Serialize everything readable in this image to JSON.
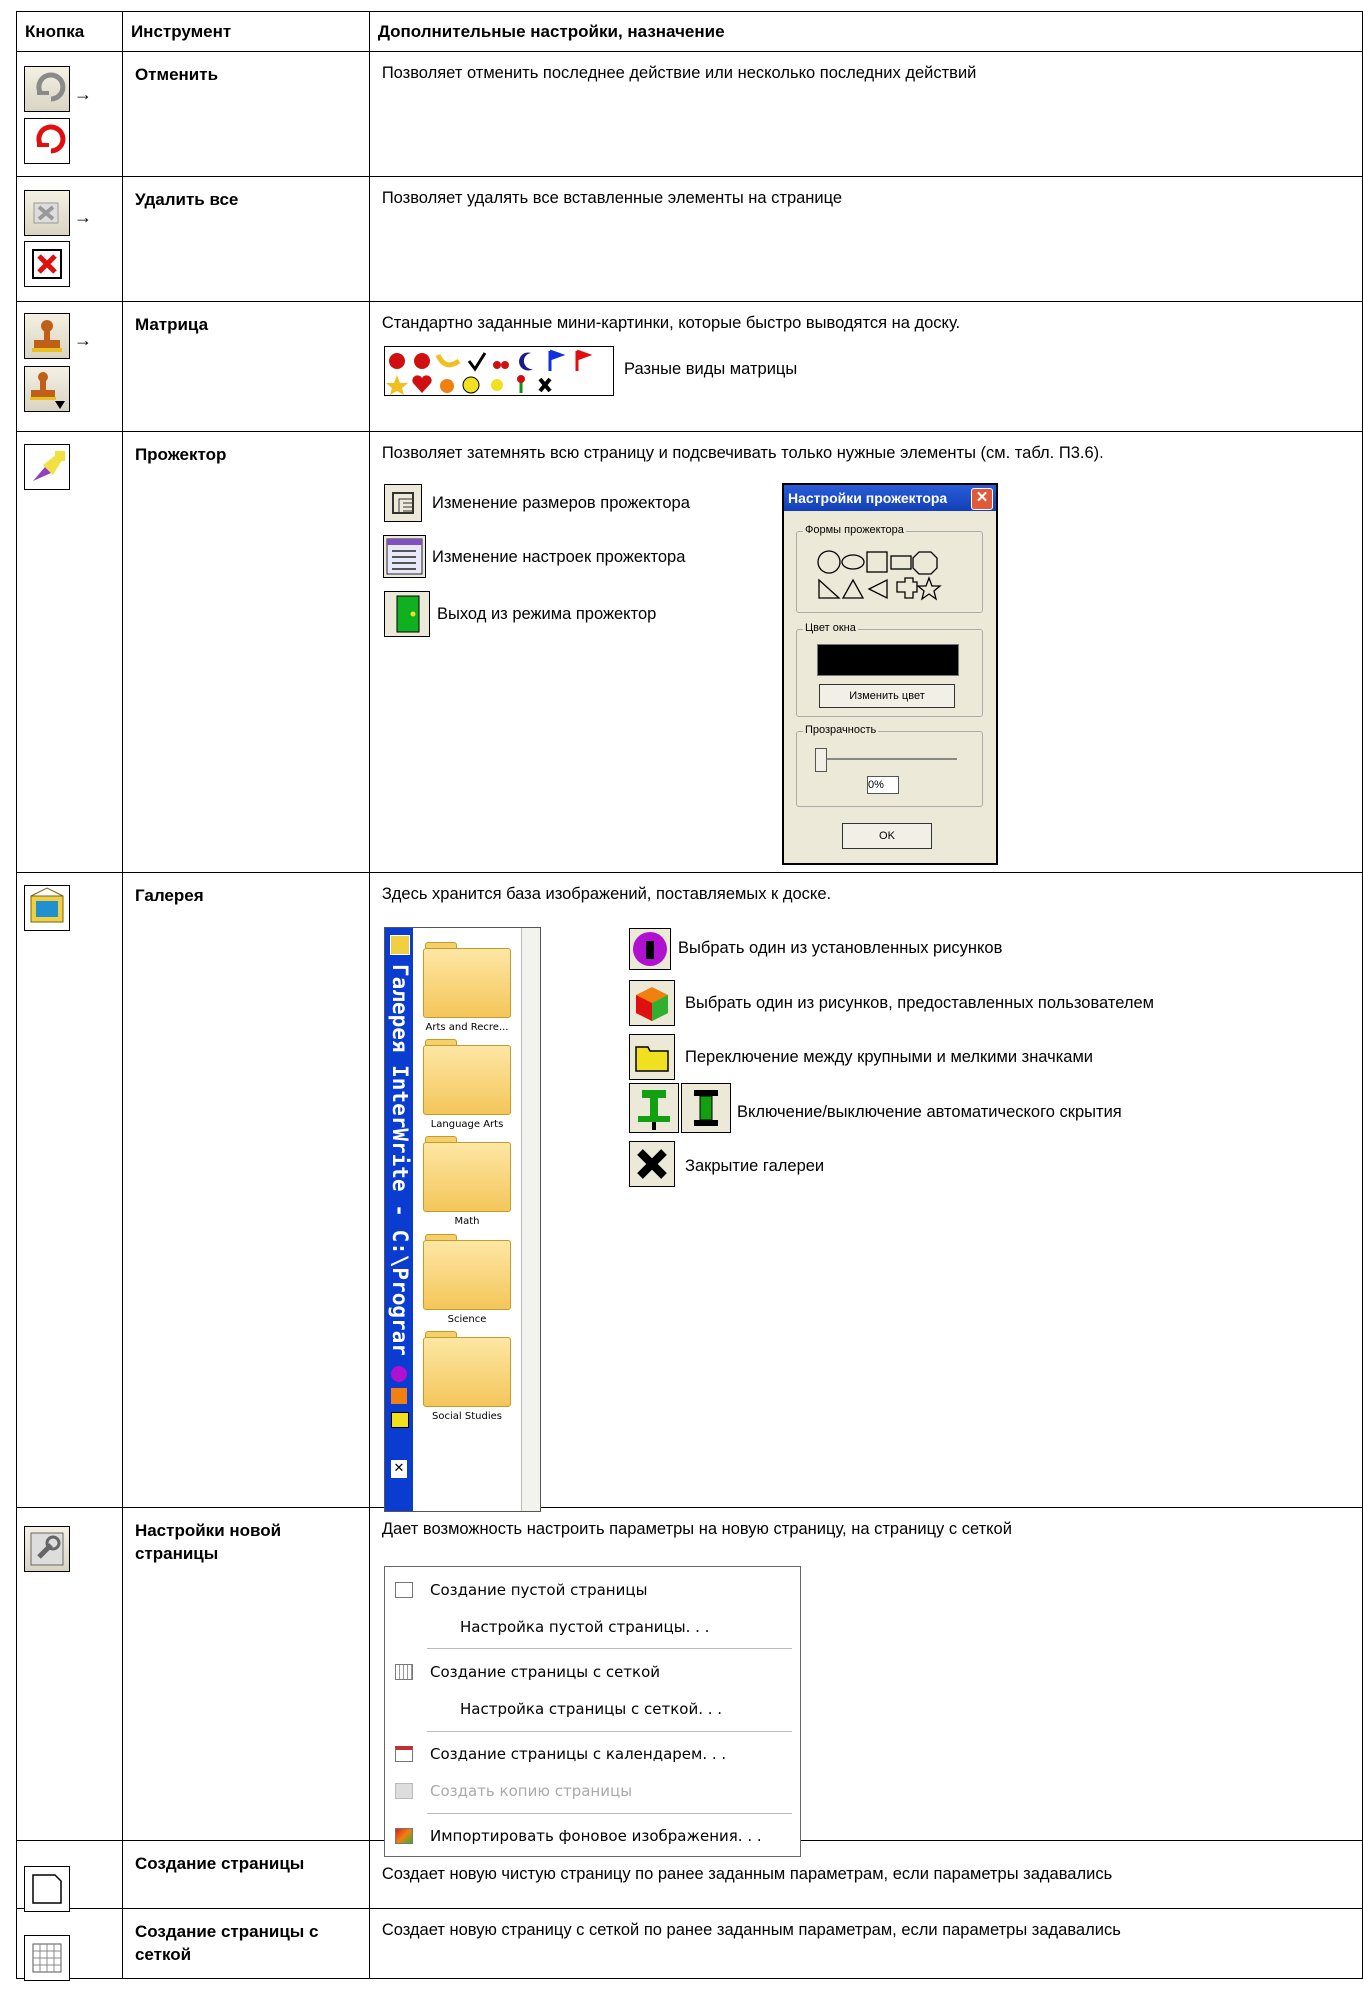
{
  "header": {
    "col1": "Кнопка",
    "col2": "Инструмент",
    "col3": "Дополнительные настройки, назначение"
  },
  "rows": [
    {
      "tool": "Отменить",
      "desc": "Позволяет отменить последнее действие или несколько последних действий"
    },
    {
      "tool": "Удалить все",
      "desc": "Позволяет удалять все вставленные элементы на странице"
    },
    {
      "tool": "Матрица",
      "desc": "Стандартно заданные мини-картинки, которые быстро выводятся на доску.",
      "extra": "Разные виды матрицы"
    },
    {
      "tool": "Прожектор",
      "desc": "Позволяет затемнять всю страницу и подсвечивать только нужные элементы (см. табл. П3.6).",
      "items": [
        "Изменение размеров прожектора",
        "Изменение настроек прожектора",
        "Выход из режима прожектор"
      ]
    },
    {
      "tool": "Галерея",
      "desc": "Здесь хранится база изображений, поставляемых к доске.",
      "items": [
        "Выбрать один из установленных рисунков",
        "Выбрать один из рисунков, предоставленных пользователем",
        "Переключение между крупными и мелкими значками",
        "Включение/выключение автоматического скрытия",
        "Закрытие галереи"
      ]
    },
    {
      "tool": "Настройки новой страницы",
      "desc": "Дает возможность настроить параметры на новую страницу, на страницу с сеткой"
    },
    {
      "tool": "Создание страницы",
      "desc": "Создает новую чистую страницу по ранее заданным параметрам, если параметры задавались"
    },
    {
      "tool": "Создание страницы с сеткой",
      "desc": "Создает новую страницу с сеткой по ранее заданным параметрам, если параметры задавались"
    }
  ],
  "arrow": "→",
  "dialog": {
    "title": "Настройки прожектора",
    "shapes_label": "Формы прожектора",
    "color_label": "Цвет окна",
    "change_color": "Изменить цвет",
    "transparency_label": "Прозрачность",
    "transparency_value": "0%",
    "ok": "OK"
  },
  "gallery": {
    "vertical_title": "Галерея InterWrite - C:\\Prograr",
    "folders": [
      "Arts and Recre...",
      "Language Arts",
      "Math",
      "Science",
      "Social Studies"
    ]
  },
  "menu": {
    "items": [
      "Создание пустой страницы",
      "Настройка пустой страницы. . .",
      "Создание страницы с сеткой",
      "Настройка страницы с сеткой. . .",
      "Создание страницы с календарем. . .",
      "Создать копию страницы",
      "Импортировать фоновое изображения. . ."
    ]
  }
}
